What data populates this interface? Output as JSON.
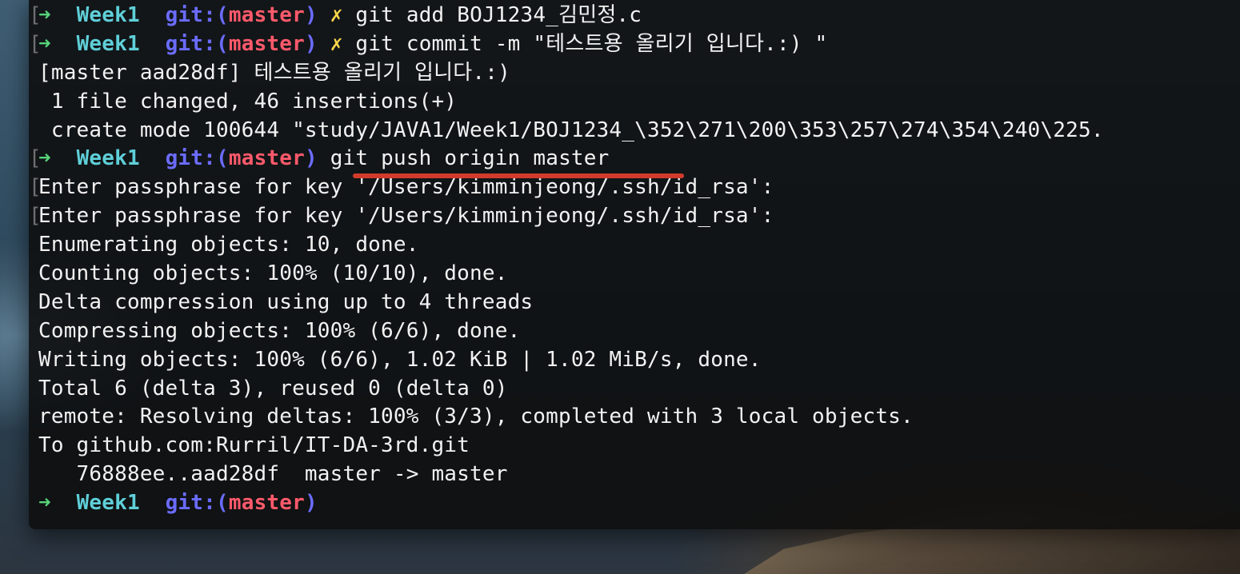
{
  "prompt": {
    "arrow": "➜",
    "dir": "Week1",
    "git_label": "git:(",
    "branch": "master",
    "git_close": ")",
    "dirty_mark": "✗"
  },
  "terminal": {
    "lines": [
      {
        "type": "prompt",
        "bracket": "[",
        "dirty": true,
        "cmd": "git add BOJ1234_김민정.c"
      },
      {
        "type": "prompt",
        "bracket": "[",
        "dirty": true,
        "cmd": "git commit -m \"테스트용 올리기 입니다.:) \""
      },
      {
        "type": "output",
        "bracket": "",
        "text": "[master aad28df] 테스트용 올리기 입니다.:)"
      },
      {
        "type": "output",
        "bracket": "",
        "text": " 1 file changed, 46 insertions(+)"
      },
      {
        "type": "output",
        "bracket": "",
        "text": " create mode 100644 \"study/JAVA1/Week1/BOJ1234_\\352\\271\\200\\353\\257\\274\\354\\240\\225."
      },
      {
        "type": "prompt",
        "bracket": "[",
        "dirty": false,
        "cmd": "git push origin master"
      },
      {
        "type": "output",
        "bracket": "[",
        "text": "Enter passphrase for key '/Users/kimminjeong/.ssh/id_rsa':"
      },
      {
        "type": "output",
        "bracket": "[",
        "text": "Enter passphrase for key '/Users/kimminjeong/.ssh/id_rsa':"
      },
      {
        "type": "output",
        "bracket": "",
        "text": "Enumerating objects: 10, done."
      },
      {
        "type": "output",
        "bracket": "",
        "text": "Counting objects: 100% (10/10), done."
      },
      {
        "type": "output",
        "bracket": "",
        "text": "Delta compression using up to 4 threads"
      },
      {
        "type": "output",
        "bracket": "",
        "text": "Compressing objects: 100% (6/6), done."
      },
      {
        "type": "output",
        "bracket": "",
        "text": "Writing objects: 100% (6/6), 1.02 KiB | 1.02 MiB/s, done."
      },
      {
        "type": "output",
        "bracket": "",
        "text": "Total 6 (delta 3), reused 0 (delta 0)"
      },
      {
        "type": "output",
        "bracket": "",
        "text": "remote: Resolving deltas: 100% (3/3), completed with 3 local objects."
      },
      {
        "type": "output",
        "bracket": "",
        "text": "To github.com:Rurril/IT-DA-3rd.git"
      },
      {
        "type": "output",
        "bracket": "",
        "text": "   76888ee..aad28df  master -> master"
      },
      {
        "type": "prompt",
        "bracket": "",
        "dirty": false,
        "cmd": ""
      }
    ]
  },
  "colors": {
    "arrow": "#56d37a",
    "dir": "#5fcfd8",
    "git": "#6b6cff",
    "branch": "#ff5a6b",
    "dirty": "#ffd84a",
    "text": "#f2f2f2",
    "annotation_underline": "#d23b2b"
  }
}
